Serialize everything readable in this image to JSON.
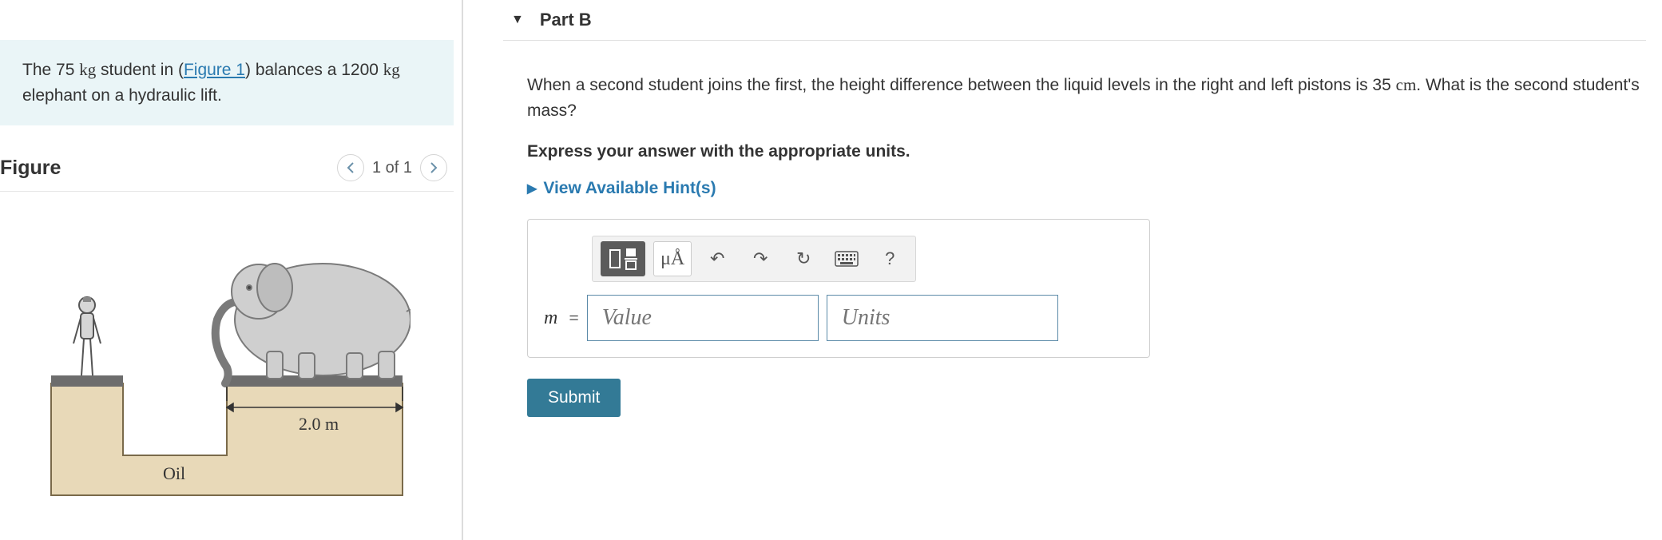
{
  "problem": {
    "text_before_link": "The 75 ",
    "kg1": "kg",
    "text_mid1": " student in (",
    "figure_link": "Figure 1",
    "text_mid2": ") balances a 1200 ",
    "kg2": "kg",
    "text_after": " elephant on a hydraulic lift."
  },
  "figure": {
    "heading": "Figure",
    "counter": "1 of 1",
    "dimension_label": "2.0 m",
    "fluid_label": "Oil"
  },
  "part": {
    "label": "Part B",
    "question_a": "When a second student joins the first, the height difference between the liquid levels in the right and left pistons is 35 ",
    "cm": "cm",
    "question_b": ". What is the second student's mass?",
    "instruction": "Express your answer with the appropriate units.",
    "hints_label": "View Available Hint(s)"
  },
  "toolbar": {
    "templates_label": "templates",
    "symbols_label": "μÅ",
    "undo": "↶",
    "redo": "↷",
    "reset": "↻",
    "keyboard": "⌨",
    "help": "?"
  },
  "answer": {
    "variable": "m",
    "equals": "=",
    "value_placeholder": "Value",
    "units_placeholder": "Units"
  },
  "actions": {
    "submit": "Submit"
  }
}
